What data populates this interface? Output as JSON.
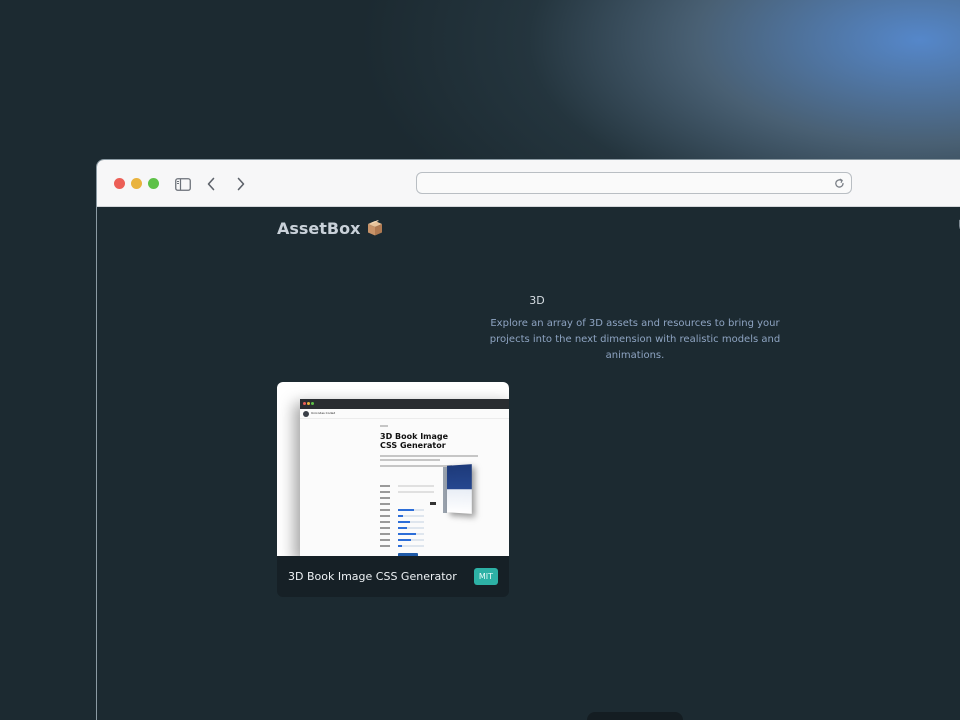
{
  "header": {
    "brand": "AssetBox"
  },
  "section": {
    "title": "3D",
    "description": "Explore an array of 3D assets and resources to bring your projects into the next dimension with realistic models and animations."
  },
  "cards": [
    {
      "title": "3D Book Image CSS Generator",
      "license": "MIT",
      "thumbnail": {
        "site_name": "Unicodes Coded",
        "heading": "3D Book Image CSS Generator"
      }
    }
  ],
  "icons": {
    "sidebar": "sidebar-icon",
    "back": "chevron-left-icon",
    "forward": "chevron-right-icon",
    "reload": "reload-icon",
    "brand": "box-icon",
    "shield": "shield-icon"
  },
  "colors": {
    "page_bg": "#1c2a31",
    "accent_glow": "#588cd2",
    "license_badge": "#2db1a5",
    "card_footer": "#162026"
  }
}
